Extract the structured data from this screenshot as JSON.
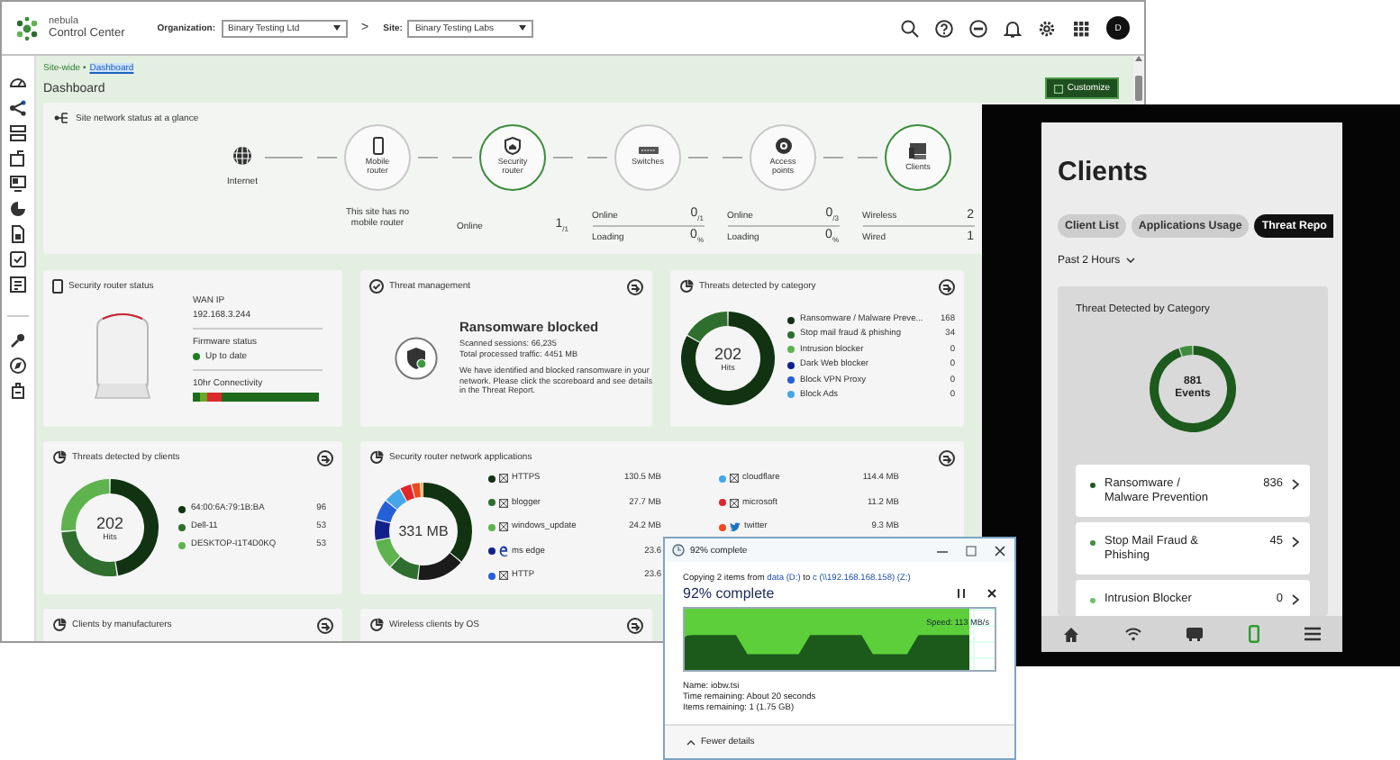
{
  "header": {
    "brand_top": "nebula",
    "brand_bottom": "Control Center",
    "org_label": "Organization:",
    "org_value": "Binary Testing Ltd",
    "separator": ">",
    "site_label": "Site:",
    "site_value": "Binary Testing Labs",
    "avatar": "D"
  },
  "breadcrumb": {
    "parent": "Site-wide •",
    "current": "Dashboard"
  },
  "page_title": "Dashboard",
  "customize_button": "Customize",
  "network_status": {
    "title": "Site network status at a glance",
    "nodes": [
      {
        "kind": "internet",
        "label": "Internet"
      },
      {
        "kind": "mobile-router",
        "label": "Mobile router",
        "active": false,
        "note": "This site has no mobile router"
      },
      {
        "kind": "security-router",
        "label": "Security router",
        "active": true,
        "stats": [
          {
            "label": "Online",
            "value": "1$_{/1}$"
          }
        ]
      },
      {
        "kind": "switch",
        "label": "Switches",
        "active": false,
        "stats": [
          {
            "label": "Online",
            "value": "0$_{/1}$"
          },
          {
            "label": "Loading",
            "value": "0$_{%}$"
          }
        ]
      },
      {
        "kind": "access-point",
        "label": "Access points",
        "active": false,
        "stats": [
          {
            "label": "Online",
            "value": "0$_{/3}$"
          },
          {
            "label": "Loading",
            "value": "0$_{%}$"
          }
        ]
      },
      {
        "kind": "clients",
        "label": "Clients",
        "active": true,
        "stats": [
          {
            "label": "Wireless",
            "value": "2"
          },
          {
            "label": "Wired",
            "value": "1"
          }
        ]
      }
    ]
  },
  "router_status": {
    "title": "Security router status",
    "wan_label": "WAN IP",
    "wan_value": "192.168.3.244",
    "firmware_label": "Firmware status",
    "firmware_value": "Up to date",
    "connectivity_label": "10hr Connectivity"
  },
  "threat_management": {
    "title": "Threat management",
    "heading": "Ransomware blocked",
    "lines": [
      "Scanned sessions: 66,235",
      "Total processed traffic: 4451 MB"
    ],
    "message": "We have identified and blocked ransomware in your network. Please click the scoreboard and see details in the Threat Report."
  },
  "threats_by_category": {
    "title": "Threats detected by category",
    "center_value": "202",
    "center_label": "Hits",
    "legend": [
      {
        "label": "Ransomware / Malware Preve...",
        "value": "168",
        "color": "#123312"
      },
      {
        "label": "Stop mail fraud & phishing",
        "value": "34",
        "color": "#2f6e2f"
      },
      {
        "label": "Intrusion blocker",
        "value": "0",
        "color": "#5fb34f"
      },
      {
        "label": "Dark Web blocker",
        "value": "0",
        "color": "#12208c"
      },
      {
        "label": "Block VPN Proxy",
        "value": "0",
        "color": "#2660d8"
      },
      {
        "label": "Block Ads",
        "value": "0",
        "color": "#45a6ea"
      }
    ],
    "chart_data": {
      "type": "donut",
      "values": [
        83.2,
        16.8,
        0,
        0,
        0,
        0
      ]
    }
  },
  "threats_by_clients": {
    "title": "Threats detected by clients",
    "center_value": "202",
    "center_label": "Hits",
    "legend": [
      {
        "label": "64:00:6A:79:1B:BA",
        "value": "96",
        "color": "#123312"
      },
      {
        "label": "Dell-11",
        "value": "53",
        "color": "#2f6e2f"
      },
      {
        "label": "DESKTOP-I1T4D0KQ",
        "value": "53",
        "color": "#5fb34f"
      }
    ],
    "chart_data": {
      "type": "donut",
      "values": [
        47.5,
        26.2,
        26.3
      ]
    }
  },
  "router_applications": {
    "title": "Security router network applications",
    "center_value": "331 MB",
    "apps": [
      {
        "kind": "app",
        "name": "HTTPS",
        "value": "130.5 MB",
        "color": "#123312"
      },
      {
        "kind": "app",
        "name": "blogger",
        "value": "27.7 MB",
        "color": "#2f6e2f"
      },
      {
        "kind": "app",
        "name": "windows_update",
        "value": "24.2 MB",
        "color": "#5fb34f"
      },
      {
        "kind": "edge",
        "name": "ms edge",
        "value": "23.6",
        "color": "#12208c"
      },
      {
        "kind": "app",
        "name": "HTTP",
        "value": "23.6",
        "color": "#2660d8"
      },
      {
        "kind": "app",
        "name": "cloudflare",
        "value": "114.4 MB",
        "color": "#45a6ea"
      },
      {
        "kind": "app",
        "name": "microsoft",
        "value": "11.2 MB",
        "color": "#e0262a"
      },
      {
        "kind": "twitter",
        "name": "twitter",
        "value": "9.3 MB",
        "color": "#ee4a22"
      }
    ]
  },
  "bottom_cards": [
    {
      "title": "Clients by manufacturers"
    },
    {
      "title": "Wireless clients by OS"
    }
  ],
  "phone": {
    "title": "Clients",
    "tabs": [
      {
        "label": "Client List",
        "selected": false
      },
      {
        "label": "Applications Usage",
        "selected": false
      },
      {
        "label": "Threat Repo",
        "selected": true
      }
    ],
    "period": "Past 2 Hours",
    "card_title": "Threat Detected by Category",
    "center_value": "881",
    "center_label": "Events",
    "items": [
      {
        "label": "Ransomware / Malware Prevention",
        "value": "836",
        "color": "#1d5a1d"
      },
      {
        "label": "Stop Mail Fraud & Phishing",
        "value": "45",
        "color": "#3d8d3d"
      },
      {
        "label": "Intrusion Blocker",
        "value": "0",
        "color": "#6fbf6f"
      }
    ],
    "chart_data": {
      "type": "donut",
      "values": [
        94.9,
        5.1,
        0
      ]
    },
    "nav": [
      {
        "kind": "home",
        "selected": false
      },
      {
        "kind": "wifi",
        "selected": false
      },
      {
        "kind": "device",
        "selected": false
      },
      {
        "kind": "phone",
        "selected": true
      },
      {
        "kind": "menu",
        "selected": false
      }
    ]
  },
  "dialog": {
    "title": "92% complete",
    "copy_prefix": "Copying 2 items from ",
    "source": "data (D:)",
    "copy_middle": " to ",
    "destination": "c (\\\\192.168.168.158) (Z:)",
    "progress_title": "92% complete",
    "level": 0.92,
    "speed": "Speed: 113 MB/s",
    "details": [
      "Name: iobw.tsi",
      "Time remaining: About 20 seconds",
      "Items remaining: 1 (1.75 GB)"
    ],
    "toggle": "Fewer details"
  }
}
